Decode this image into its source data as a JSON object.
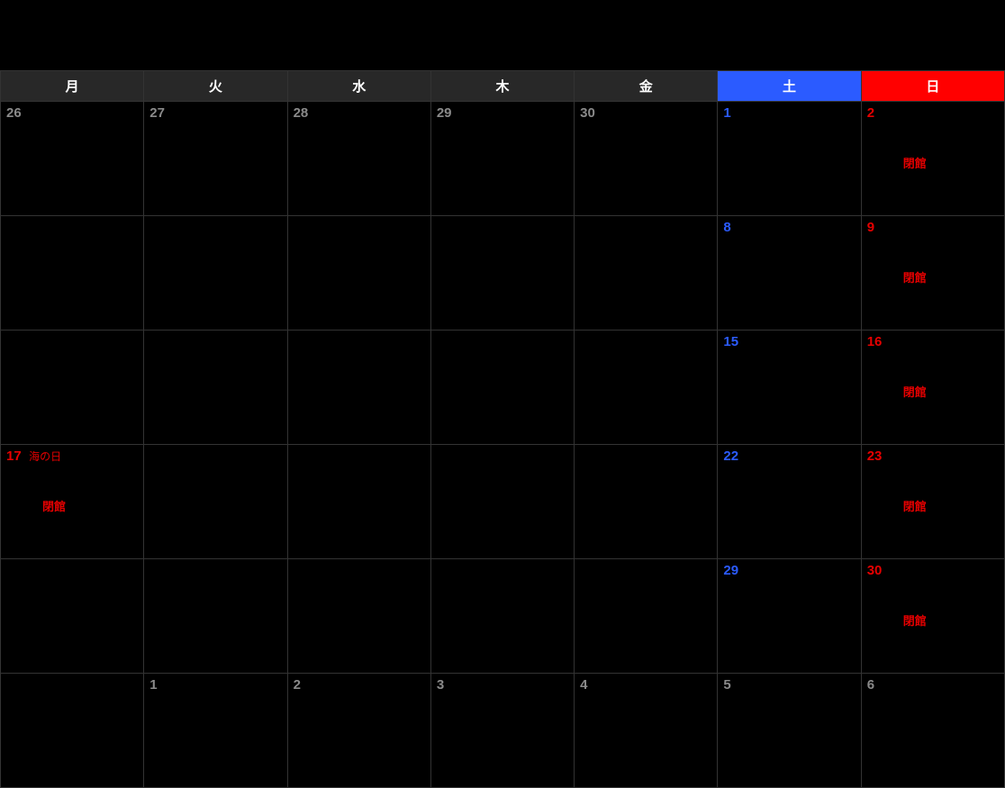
{
  "headers": [
    "月",
    "火",
    "水",
    "木",
    "金",
    "土",
    "日"
  ],
  "closed_label": "閉館",
  "holiday_label": "海の日",
  "weeks": [
    [
      {
        "num": "26",
        "class": "muted"
      },
      {
        "num": "27",
        "class": "muted"
      },
      {
        "num": "28",
        "class": "muted"
      },
      {
        "num": "29",
        "class": "muted"
      },
      {
        "num": "30",
        "class": "muted"
      },
      {
        "num": "1",
        "class": "sat"
      },
      {
        "num": "2",
        "class": "sun",
        "event": "closed"
      }
    ],
    [
      {
        "num": ""
      },
      {
        "num": ""
      },
      {
        "num": ""
      },
      {
        "num": ""
      },
      {
        "num": ""
      },
      {
        "num": "8",
        "class": "sat"
      },
      {
        "num": "9",
        "class": "sun",
        "event": "closed"
      }
    ],
    [
      {
        "num": ""
      },
      {
        "num": ""
      },
      {
        "num": ""
      },
      {
        "num": ""
      },
      {
        "num": ""
      },
      {
        "num": "15",
        "class": "sat"
      },
      {
        "num": "16",
        "class": "sun",
        "event": "closed"
      }
    ],
    [
      {
        "num": "17",
        "class": "holiday",
        "holiday": true,
        "event": "closed"
      },
      {
        "num": ""
      },
      {
        "num": ""
      },
      {
        "num": ""
      },
      {
        "num": ""
      },
      {
        "num": "22",
        "class": "sat"
      },
      {
        "num": "23",
        "class": "sun",
        "event": "closed"
      }
    ],
    [
      {
        "num": ""
      },
      {
        "num": ""
      },
      {
        "num": ""
      },
      {
        "num": ""
      },
      {
        "num": ""
      },
      {
        "num": "29",
        "class": "sat"
      },
      {
        "num": "30",
        "class": "sun",
        "event": "closed"
      }
    ],
    [
      {
        "num": ""
      },
      {
        "num": "1",
        "class": "muted"
      },
      {
        "num": "2",
        "class": "muted"
      },
      {
        "num": "3",
        "class": "muted"
      },
      {
        "num": "4",
        "class": "muted"
      },
      {
        "num": "5",
        "class": "muted"
      },
      {
        "num": "6",
        "class": "muted"
      }
    ]
  ]
}
